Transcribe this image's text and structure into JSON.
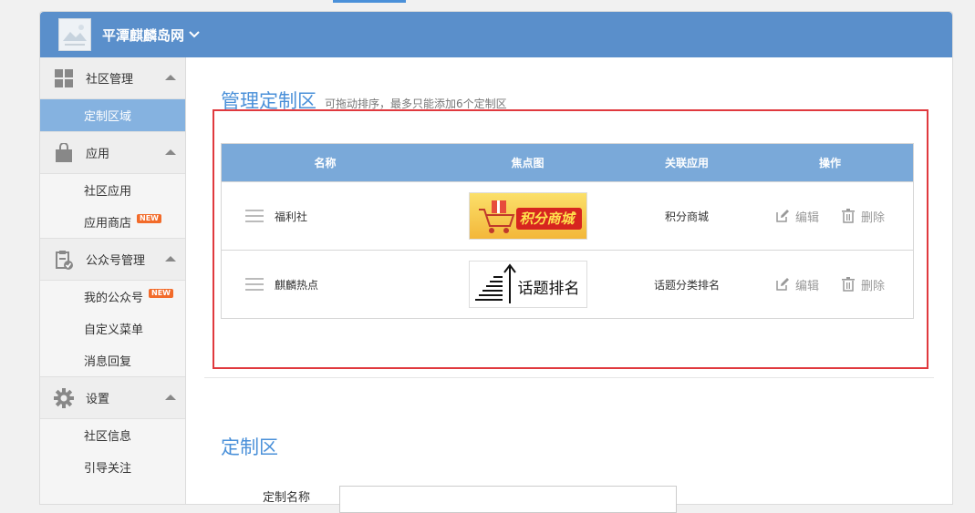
{
  "header": {
    "site_name": "平潭麒麟岛网"
  },
  "sidebar": {
    "sections": [
      {
        "label": "社区管理",
        "items": [
          {
            "label": "定制区域",
            "active": true
          }
        ]
      },
      {
        "label": "应用",
        "items": [
          {
            "label": "社区应用"
          },
          {
            "label": "应用商店",
            "badge": "NEW"
          }
        ]
      },
      {
        "label": "公众号管理",
        "items": [
          {
            "label": "我的公众号",
            "badge": "NEW"
          },
          {
            "label": "自定义菜单"
          },
          {
            "label": "消息回复"
          }
        ]
      },
      {
        "label": "设置",
        "items": [
          {
            "label": "社区信息"
          },
          {
            "label": "引导关注"
          }
        ]
      }
    ]
  },
  "main": {
    "title": "管理定制区",
    "subtitle": "可拖动排序，最多只能添加6个定制区",
    "table": {
      "headers": [
        "名称",
        "焦点图",
        "关联应用",
        "操作"
      ],
      "rows": [
        {
          "name": "福利社",
          "image_text": "积分商城",
          "app": "积分商城",
          "edit": "编辑",
          "delete": "删除"
        },
        {
          "name": "麒麟热点",
          "image_text": "话题排名",
          "app": "话题分类排名",
          "edit": "编辑",
          "delete": "删除"
        }
      ]
    },
    "section2_title": "定制区",
    "field_label": "定制名称"
  },
  "colors": {
    "accent": "#4a90d9",
    "header_bg": "#5a8fcb",
    "table_head": "#7aa9d9",
    "active_item": "#85b2e0",
    "highlight_box": "#e0393e",
    "new_badge": "#f26b2a"
  }
}
